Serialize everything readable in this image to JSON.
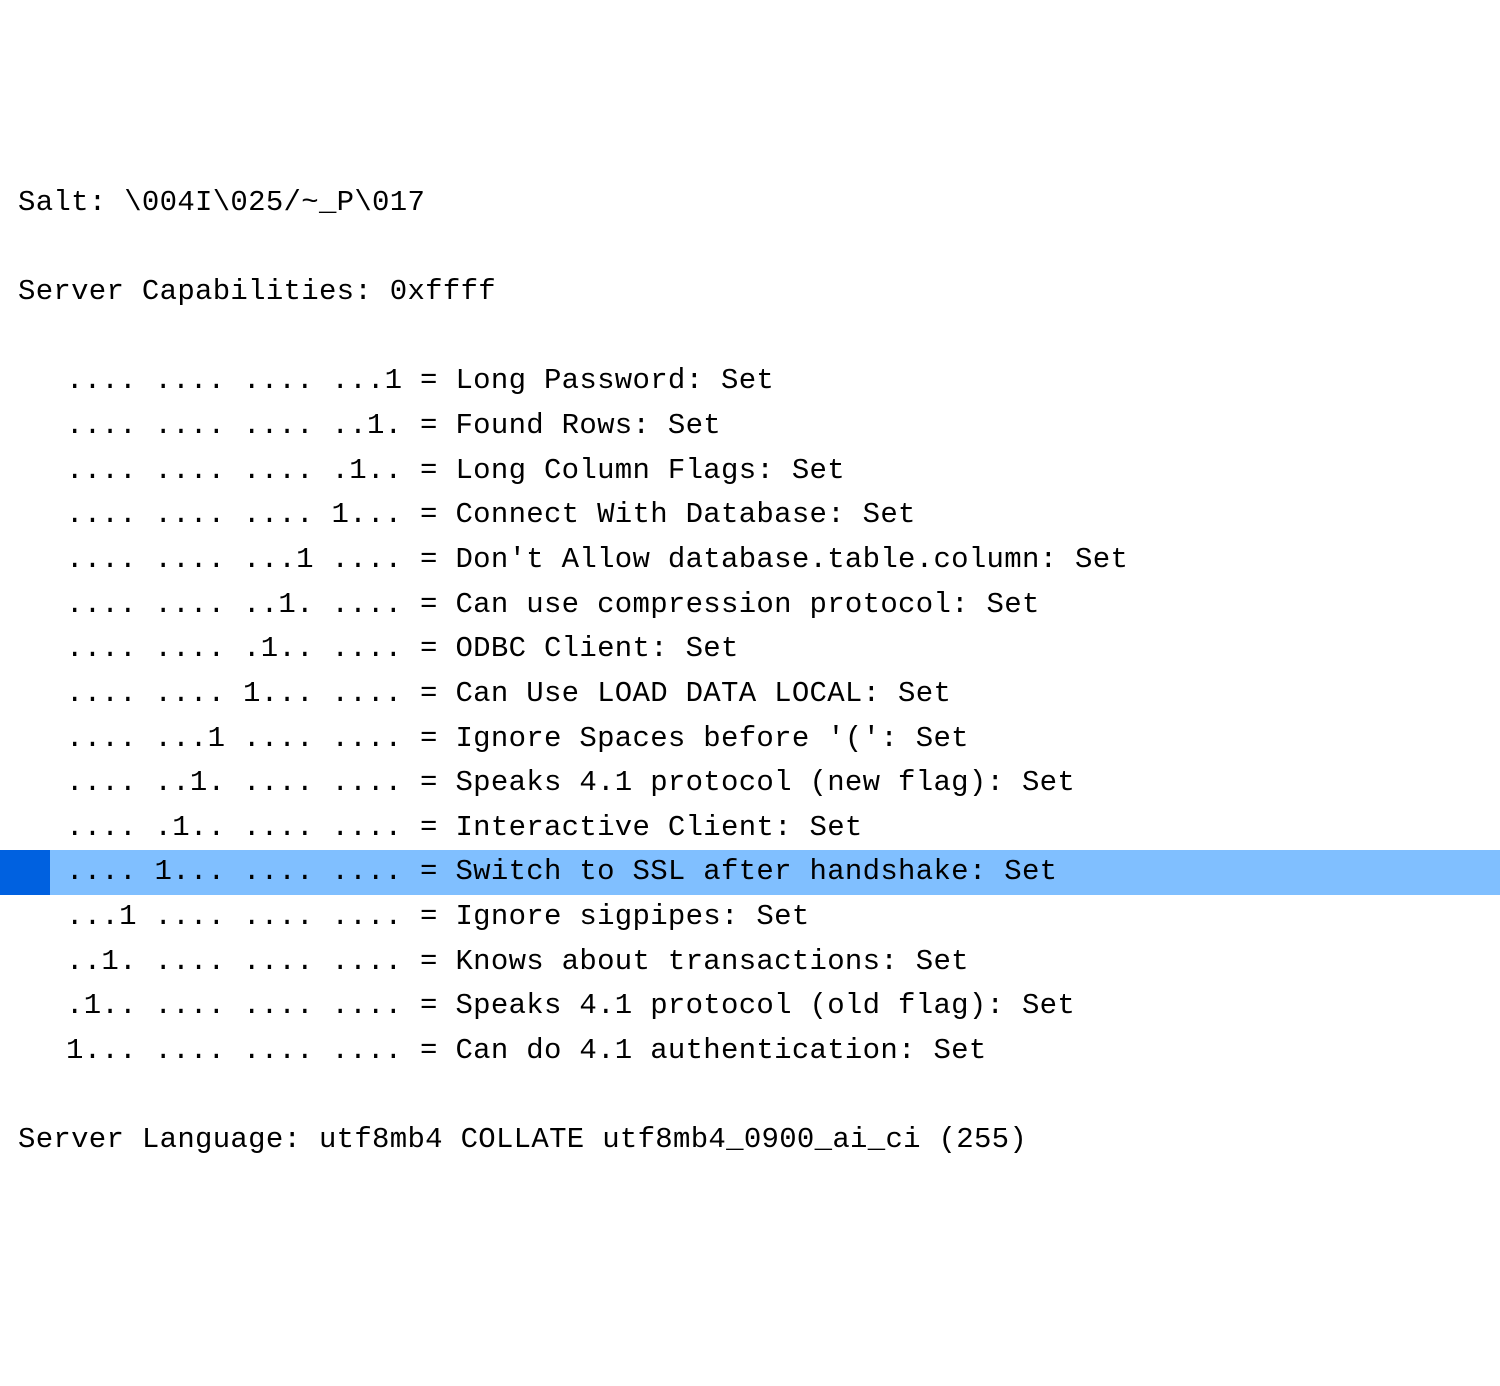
{
  "salt": "Salt: \\004I\\025/~_P\\017",
  "capabilities_header": "Server Capabilities: 0xffff",
  "flags": [
    {
      "bits": ".... .... .... ...1",
      "label": "Long Password: Set",
      "highlighted": false
    },
    {
      "bits": ".... .... .... ..1.",
      "label": "Found Rows: Set",
      "highlighted": false
    },
    {
      "bits": ".... .... .... .1..",
      "label": "Long Column Flags: Set",
      "highlighted": false
    },
    {
      "bits": ".... .... .... 1...",
      "label": "Connect With Database: Set",
      "highlighted": false
    },
    {
      "bits": ".... .... ...1 ....",
      "label": "Don't Allow database.table.column: Set",
      "highlighted": false
    },
    {
      "bits": ".... .... ..1. ....",
      "label": "Can use compression protocol: Set",
      "highlighted": false
    },
    {
      "bits": ".... .... .1.. ....",
      "label": "ODBC Client: Set",
      "highlighted": false
    },
    {
      "bits": ".... .... 1... ....",
      "label": "Can Use LOAD DATA LOCAL: Set",
      "highlighted": false
    },
    {
      "bits": ".... ...1 .... ....",
      "label": "Ignore Spaces before '(': Set",
      "highlighted": false
    },
    {
      "bits": ".... ..1. .... ....",
      "label": "Speaks 4.1 protocol (new flag): Set",
      "highlighted": false
    },
    {
      "bits": ".... .1.. .... ....",
      "label": "Interactive Client: Set",
      "highlighted": false
    },
    {
      "bits": ".... 1... .... ....",
      "label": "Switch to SSL after handshake: Set",
      "highlighted": true
    },
    {
      "bits": "...1 .... .... ....",
      "label": "Ignore sigpipes: Set",
      "highlighted": false
    },
    {
      "bits": "..1. .... .... ....",
      "label": "Knows about transactions: Set",
      "highlighted": false
    },
    {
      "bits": ".1.. .... .... ....",
      "label": "Speaks 4.1 protocol (old flag): Set",
      "highlighted": false
    },
    {
      "bits": "1... .... .... ....",
      "label": "Can do 4.1 authentication: Set",
      "highlighted": false
    }
  ],
  "server_language": "Server Language: utf8mb4 COLLATE utf8mb4_0900_ai_ci (255)"
}
